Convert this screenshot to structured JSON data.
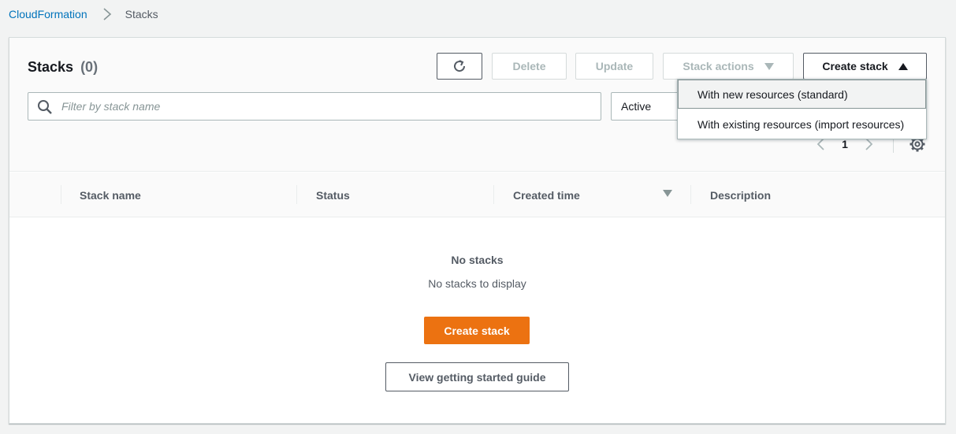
{
  "breadcrumb": {
    "root": "CloudFormation",
    "current": "Stacks"
  },
  "header": {
    "title": "Stacks",
    "count": "(0)"
  },
  "toolbar": {
    "delete_label": "Delete",
    "update_label": "Update",
    "stack_actions_label": "Stack actions",
    "create_stack_label": "Create stack"
  },
  "filter": {
    "placeholder": "Filter by stack name",
    "status_value": "Active"
  },
  "dropdown": {
    "items": [
      {
        "label": "With new resources (standard)"
      },
      {
        "label": "With existing resources (import resources)"
      }
    ]
  },
  "pagination": {
    "current_page": "1"
  },
  "table": {
    "columns": [
      "Stack name",
      "Status",
      "Created time",
      "Description"
    ],
    "rows": []
  },
  "empty": {
    "title": "No stacks",
    "subtitle": "No stacks to display",
    "create_label": "Create stack",
    "guide_label": "View getting started guide"
  },
  "colors": {
    "primary": "#ec7211",
    "link": "#0073bb"
  }
}
